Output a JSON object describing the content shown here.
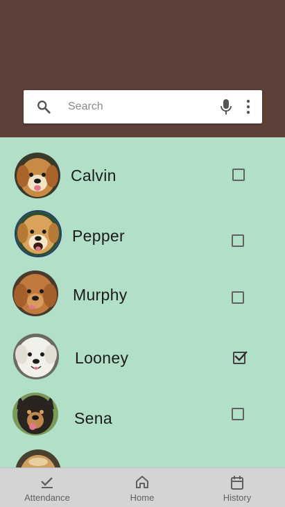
{
  "search": {
    "placeholder": "Search",
    "value": ""
  },
  "dogs": [
    {
      "name": "Calvin",
      "checked": false
    },
    {
      "name": "Pepper",
      "checked": false
    },
    {
      "name": "Murphy",
      "checked": false
    },
    {
      "name": "Looney",
      "checked": true
    },
    {
      "name": "Sena",
      "checked": false
    }
  ],
  "bottom_nav": {
    "items": [
      {
        "label": "Attendance",
        "icon": "check-icon"
      },
      {
        "label": "Home",
        "icon": "home-icon"
      },
      {
        "label": "History",
        "icon": "calendar-icon"
      }
    ]
  },
  "colors": {
    "header": "#5d4037",
    "list_background": "#b2dfc8",
    "nav_background": "#d4d4d4"
  }
}
